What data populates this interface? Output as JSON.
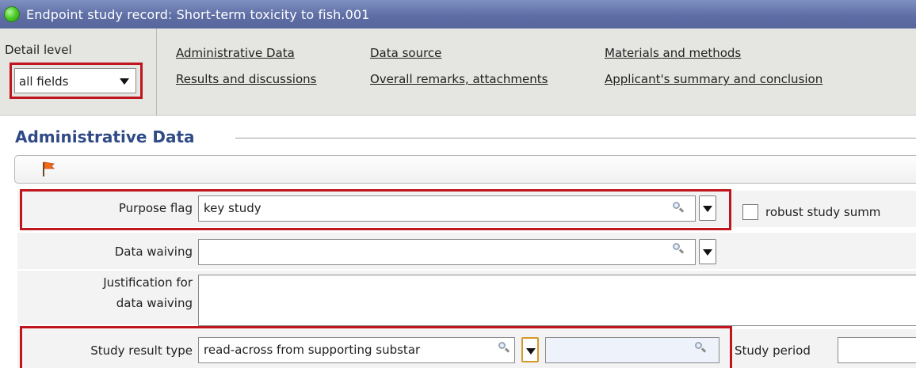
{
  "window": {
    "title": "Endpoint study record: Short-term toxicity to fish.001",
    "status_icon": "green-status-icon"
  },
  "toolbar": {
    "detail_level_label": "Detail level",
    "detail_level_value": "all fields",
    "links": [
      "Administrative Data",
      "Data source",
      "Materials and methods",
      "Results and discussions",
      "Overall remarks, attachments",
      "Applicant's summary and conclusion"
    ]
  },
  "section": {
    "title": "Administrative Data",
    "flag_icon": "flag-icon"
  },
  "form": {
    "purpose_flag_label": "Purpose flag",
    "purpose_flag_value": "key study",
    "robust_summary_label": "robust study summ",
    "data_waiving_label": "Data waiving",
    "data_waiving_value": "",
    "justification_label_line1": "Justification for",
    "justification_label_line2": "data waiving",
    "justification_value": "",
    "study_result_type_label": "Study result type",
    "study_result_type_value": "read-across from supporting substar",
    "study_result_type_secondary": "",
    "study_period_label": "Study period",
    "study_period_value": ""
  },
  "colors": {
    "titlebar": "#6a7aaf",
    "section_title": "#304a86",
    "highlight_box": "#c0151d",
    "toolbar_bg": "#e5e5e2"
  }
}
